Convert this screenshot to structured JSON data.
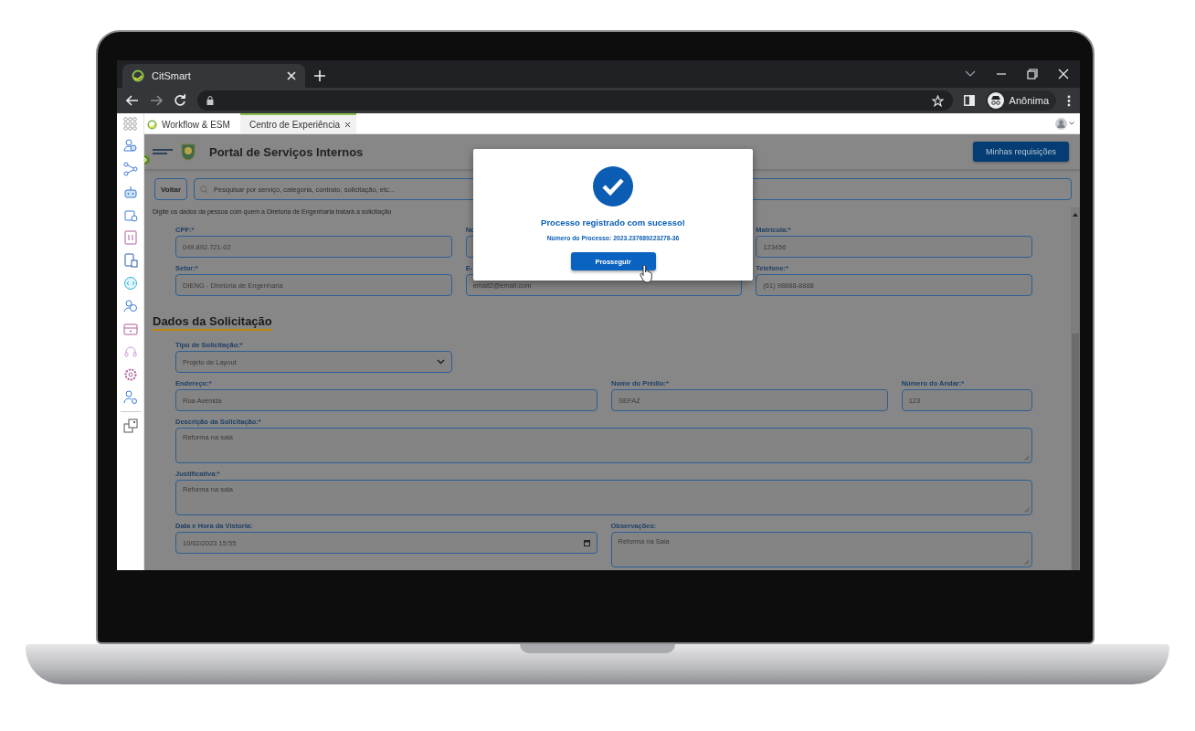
{
  "browser": {
    "tab_title": "CitSmart",
    "profile_label": "Anônima"
  },
  "app_tabs": [
    {
      "label": "Workflow & ESM",
      "selected": false
    },
    {
      "label": "Centro de Experiência",
      "selected": true
    }
  ],
  "portal": {
    "title": "Portal de Serviços Internos",
    "requests_button": "Minhas requisições",
    "back_button": "Voltar",
    "search_placeholder": "Pesquisar por serviço, categoria, contrato, solicitação, etc...",
    "instruction": "Digite os dados da pessoa com quem a Diretoria de Engenharia tratará a solicitação"
  },
  "sections": [
    {
      "rows": [
        [
          {
            "label": "CPF:*",
            "value": "049.892.721-02",
            "kind": "text"
          },
          {
            "label": "No",
            "kind": "text"
          },
          {
            "label": "Matrícula:*",
            "value": "123456",
            "kind": "text"
          }
        ],
        [
          {
            "label": "Setor:*",
            "value": "DIENG - Diretoria de Engenharia",
            "kind": "text"
          },
          {
            "label": "E-",
            "value": "email2@email.com",
            "kind": "text"
          },
          {
            "label": "Telefone:*",
            "value": "(61) 98888-8888",
            "kind": "text"
          }
        ]
      ]
    },
    {
      "heading": "Dados da Solicitação",
      "rows": [
        [
          {
            "label": "Tipo de Solicitação:*",
            "value": "Projeto de Layout",
            "kind": "select"
          }
        ],
        [
          {
            "label": "Endereço:*",
            "value": "Rua Avenida",
            "kind": "text"
          },
          {
            "label": "Nome do Prédio:*",
            "value": "SEFAZ",
            "kind": "text"
          },
          {
            "label": "Número do Andar:*",
            "value": "123",
            "kind": "text"
          }
        ],
        [
          {
            "label": "Descrição da Solicitação:*",
            "value": "Reforma na sala",
            "kind": "textarea"
          }
        ],
        [
          {
            "label": "Justificativa:*",
            "value": "Reforma na sala",
            "kind": "textarea"
          }
        ],
        [
          {
            "label": "Data e Hora da Vistoria:",
            "value": "10/02/2023 15:55",
            "kind": "date"
          },
          {
            "label": "Observações:",
            "value": "Reforma na Sala",
            "kind": "textarea"
          }
        ]
      ]
    }
  ],
  "modal": {
    "title": "Processo registrado com sucesso!",
    "process_number": "Número do Processo: 2023.237689223278-36",
    "button": "Prosseguir"
  }
}
